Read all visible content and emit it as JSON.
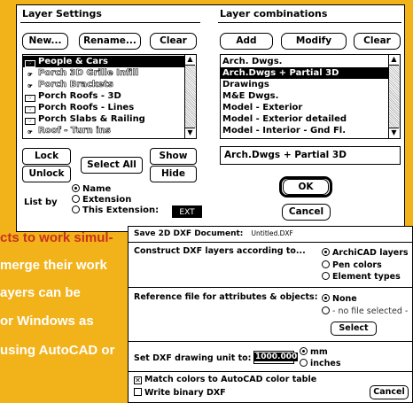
{
  "layer_settings": {
    "title": "Layer Settings",
    "buttons": {
      "new": "New...",
      "rename": "Rename...",
      "clear": "Clear"
    },
    "layers": [
      {
        "name": "People & Cars",
        "selected": true
      },
      {
        "name": "Porch 3D Grille Infill",
        "hollow": true
      },
      {
        "name": "Porch Brackets",
        "hollow": true
      },
      {
        "name": "Porch Roofs - 3D"
      },
      {
        "name": "Porch Roofs - Lines"
      },
      {
        "name": "Porch Slabs & Railing"
      },
      {
        "name": "Roof - Turn ins",
        "hollow": true
      }
    ],
    "lock": "Lock",
    "unlock": "Unlock",
    "select_all": "Select All",
    "show": "Show",
    "hide": "Hide",
    "list_by_label": "List by",
    "list_by_options": [
      "Name",
      "Extension",
      "This Extension:"
    ],
    "list_by_selected": "Name",
    "extension_value": "EXT"
  },
  "layer_combinations": {
    "title": "Layer combinations",
    "buttons": {
      "add": "Add",
      "modify": "Modify",
      "clear": "Clear"
    },
    "items": [
      {
        "name": "Arch. Dwgs."
      },
      {
        "name": "Arch.Dwgs + Partial 3D",
        "selected": true
      },
      {
        "name": "Drawings"
      },
      {
        "name": "M&E Dwgs."
      },
      {
        "name": "Model - Exterior"
      },
      {
        "name": "Model - Exterior detailed"
      },
      {
        "name": "Model - Interior - Gnd Fl."
      }
    ],
    "name_field": "Arch.Dwgs + Partial 3D",
    "ok": "OK",
    "cancel": "Cancel"
  },
  "dxf_dialog": {
    "title": "Save 2D DXF Document:",
    "filename": "Untitled.DXF",
    "construct_label": "Construct DXF layers according to...",
    "construct_options": [
      "ArchiCAD layers",
      "Pen colors",
      "Element types"
    ],
    "construct_selected": "ArchiCAD layers",
    "reference_label": "Reference file for attributes & objects:",
    "reference_options": [
      "None",
      "- no file selected -"
    ],
    "reference_selected": "None",
    "select_button": "Select",
    "unit_label": "Set DXF drawing unit to:",
    "unit_value": "1000.000",
    "unit_options": [
      "mm",
      "inches"
    ],
    "unit_selected": "mm",
    "match_colors_label": "Match colors to AutoCAD color table",
    "match_colors_checked": true,
    "binary_label": "Write binary DXF",
    "binary_checked": false,
    "cancel": "Cancel"
  },
  "article": {
    "lines": [
      "cts to work simul-",
      "merge their work",
      "ayers can be",
      "or Windows as",
      "using AutoCAD or"
    ],
    "first_line_color": "#c8321e",
    "text_color": "#ffffff",
    "background_color": "#f2b21a"
  }
}
